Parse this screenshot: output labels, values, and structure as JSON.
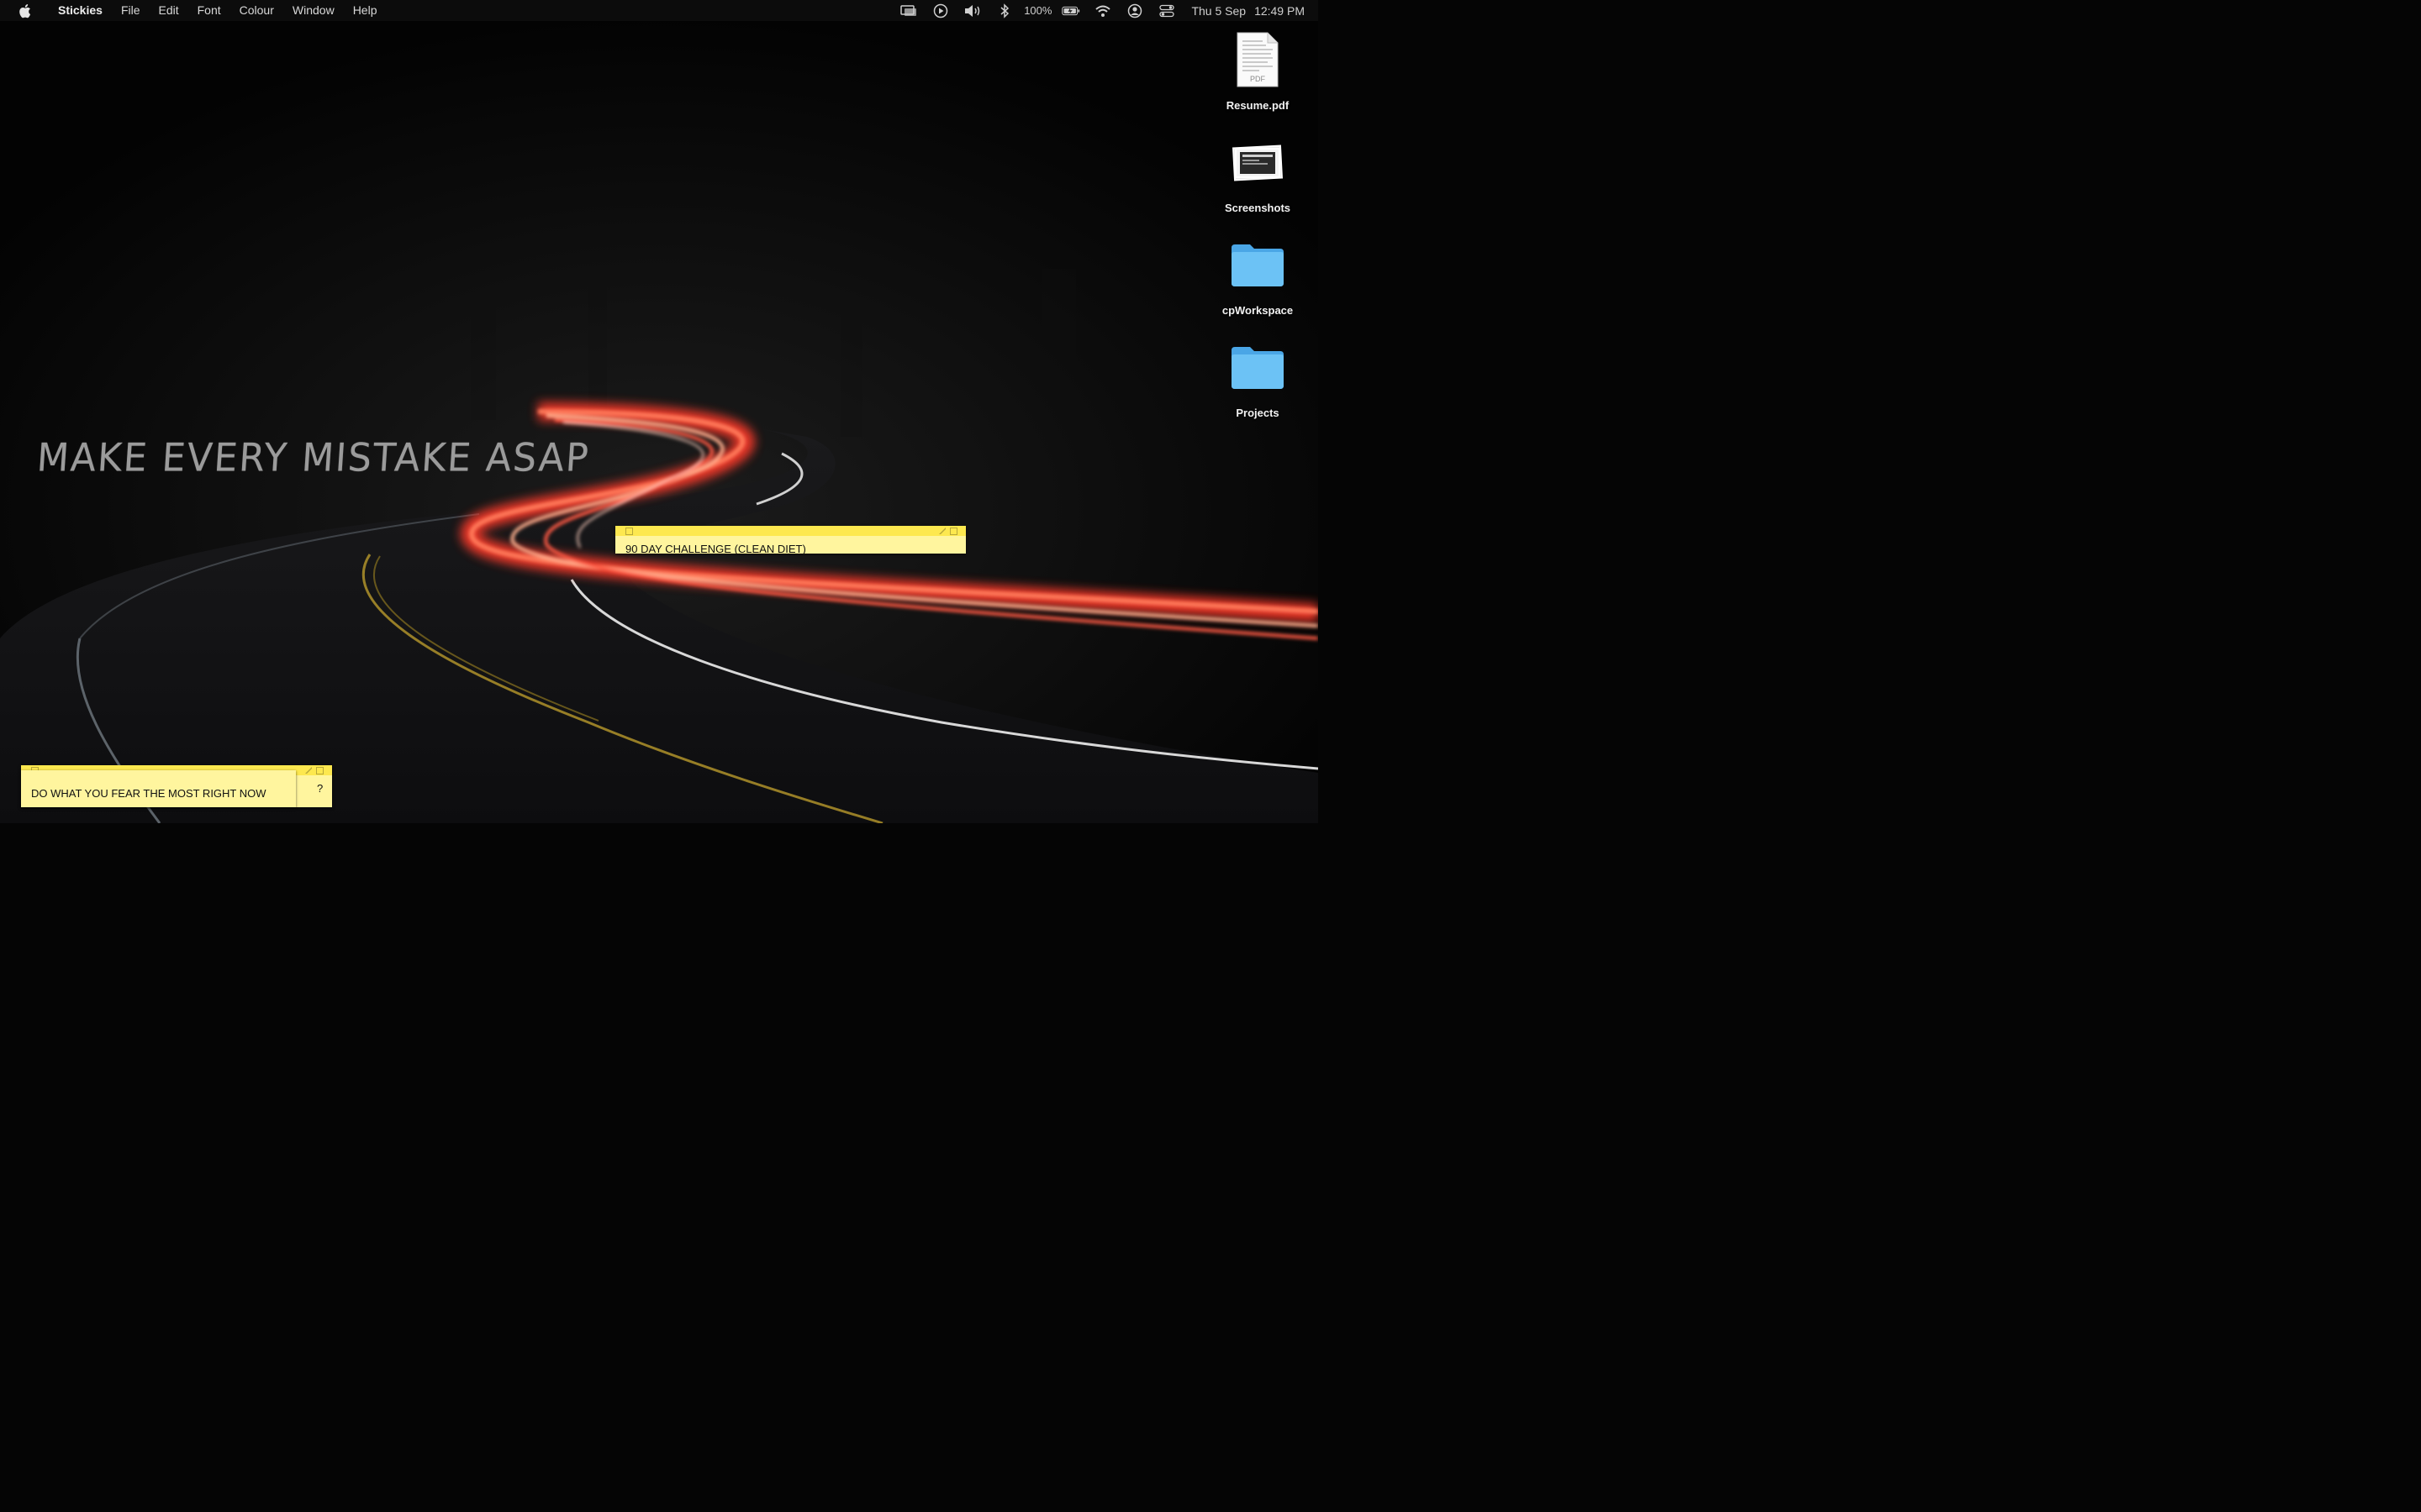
{
  "menubar": {
    "app_name": "Stickies",
    "menus": [
      "File",
      "Edit",
      "Font",
      "Colour",
      "Window",
      "Help"
    ],
    "battery_percent": "100%",
    "date": "Thu 5 Sep",
    "time": "12:49 PM"
  },
  "desktop_icons": [
    {
      "label": "Resume.pdf",
      "icon": "pdf-document-icon",
      "badge": "PDF"
    },
    {
      "label": "Screenshots",
      "icon": "screenshots-folder-icon"
    },
    {
      "label": "cpWorkspace",
      "icon": "folder-icon"
    },
    {
      "label": "Projects",
      "icon": "folder-icon"
    }
  ],
  "wallpaper": {
    "motto": "MAKE EVERY MISTAKE ASAP"
  },
  "stickies": [
    {
      "text": "90 DAY CHALLENGE (CLEAN DIET)"
    },
    {
      "text": "?"
    },
    {
      "text": "DO WHAT YOU FEAR THE MOST RIGHT NOW"
    }
  ],
  "colors": {
    "sticky_body": "#fff59e",
    "sticky_bar": "#fde84f",
    "folder_blue": "#5ab4f0",
    "light_trail": "#ff4a3a"
  }
}
